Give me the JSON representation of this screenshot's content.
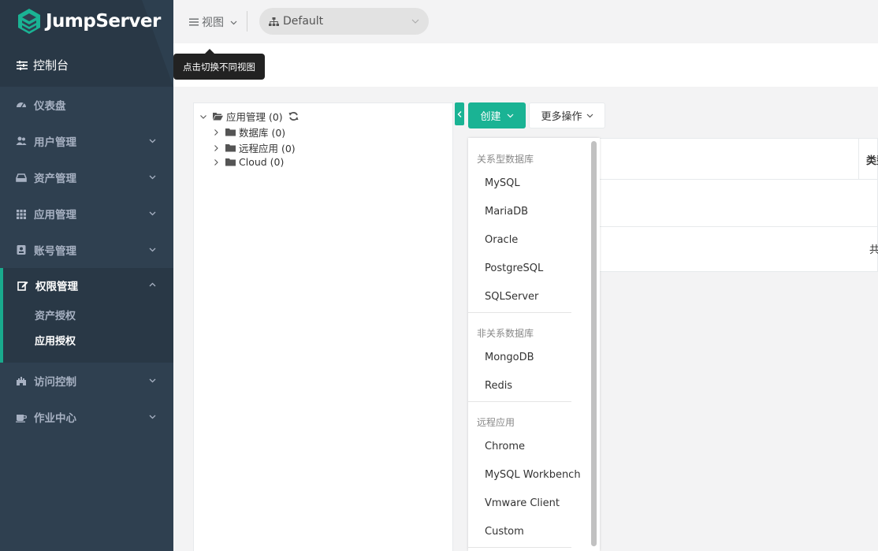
{
  "brand": {
    "name": "JumpServer"
  },
  "sidebar": {
    "console": "控制台",
    "items": [
      {
        "label": "仪表盘",
        "icon": "dashboard-icon"
      },
      {
        "label": "用户管理",
        "icon": "users-icon"
      },
      {
        "label": "资产管理",
        "icon": "inbox-icon"
      },
      {
        "label": "应用管理",
        "icon": "grid-icon"
      },
      {
        "label": "账号管理",
        "icon": "id-card-icon"
      },
      {
        "label": "权限管理",
        "icon": "edit-icon",
        "expanded": true,
        "children": [
          "资产授权",
          "应用授权"
        ],
        "active_child": "应用授权"
      },
      {
        "label": "访问控制",
        "icon": "castle-icon"
      },
      {
        "label": "作业中心",
        "icon": "coffee-icon"
      }
    ]
  },
  "topbar": {
    "view_label": "视图",
    "org_value": "Default",
    "tooltip": "点击切换不同视图"
  },
  "tree": {
    "root": "应用管理 (0)",
    "children": [
      "数据库 (0)",
      "远程应用 (0)",
      "Cloud (0)"
    ]
  },
  "toolbar": {
    "create_label": "创建",
    "more_label": "更多操作"
  },
  "table": {
    "header_partial": "类型",
    "footer_partial": "共"
  },
  "dropdown": {
    "groups": [
      {
        "title": "关系型数据库",
        "items": [
          "MySQL",
          "MariaDB",
          "Oracle",
          "PostgreSQL",
          "SQLServer"
        ]
      },
      {
        "title": "非关系数据库",
        "items": [
          "MongoDB",
          "Redis"
        ]
      },
      {
        "title": "远程应用",
        "items": [
          "Chrome",
          "MySQL Workbench",
          "Vmware Client",
          "Custom"
        ]
      }
    ]
  },
  "colors": {
    "sidebar_bg": "#2f4050",
    "accent": "#1ab394",
    "tooltip_bg": "#222222"
  }
}
